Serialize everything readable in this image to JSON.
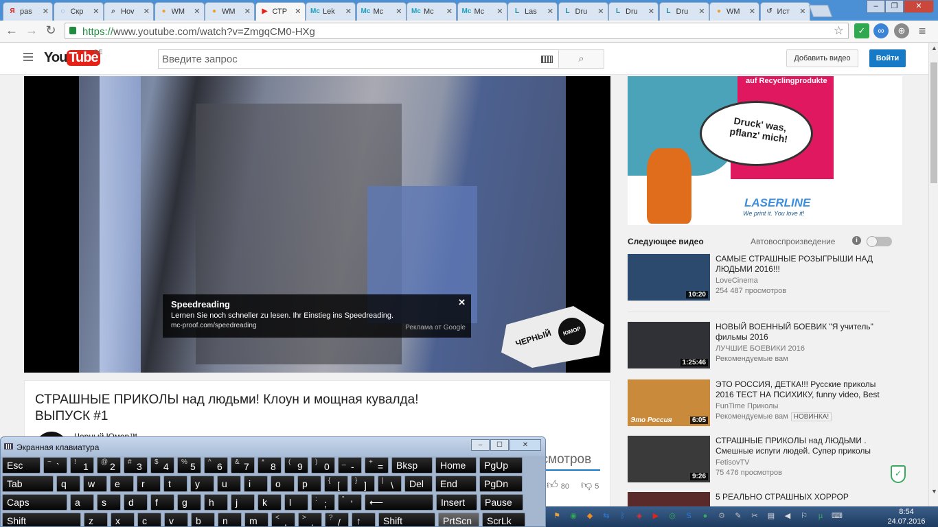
{
  "browser": {
    "tabs": [
      {
        "favicon": "Я",
        "favicon_color": "#e62117",
        "label": "pas"
      },
      {
        "favicon": "◌",
        "favicon_color": "#1a73e8",
        "label": "Скр"
      },
      {
        "favicon": "⌕",
        "favicon_color": "#555555",
        "label": "Hov"
      },
      {
        "favicon": "●",
        "favicon_color": "#f0a030",
        "label": "WM"
      },
      {
        "favicon": "●",
        "favicon_color": "#f0a030",
        "label": "WM"
      },
      {
        "favicon": "▶",
        "favicon_color": "#e62117",
        "label": "СТР",
        "active": true
      },
      {
        "favicon": "Mc",
        "favicon_color": "#1da1c1",
        "label": "Lek"
      },
      {
        "favicon": "Mc",
        "favicon_color": "#1da1c1",
        "label": "Mc"
      },
      {
        "favicon": "Mc",
        "favicon_color": "#1da1c1",
        "label": "Mc"
      },
      {
        "favicon": "Mc",
        "favicon_color": "#1da1c1",
        "label": "Mc"
      },
      {
        "favicon": "L",
        "favicon_color": "#1b8a9c",
        "label": "Las"
      },
      {
        "favicon": "L",
        "favicon_color": "#1b8a9c",
        "label": "Dru"
      },
      {
        "favicon": "L",
        "favicon_color": "#1b8a9c",
        "label": "Dru"
      },
      {
        "favicon": "L",
        "favicon_color": "#1b8a9c",
        "label": "Dru"
      },
      {
        "favicon": "●",
        "favicon_color": "#f0a030",
        "label": "WM"
      },
      {
        "favicon": "↺",
        "favicon_color": "#555555",
        "label": "Ист"
      }
    ],
    "url_scheme": "https://",
    "url_rest": "www.youtube.com/watch?v=ZmgqCM0-HXg",
    "window_buttons": {
      "minimize": "‒",
      "maximize": "❐",
      "close": "✕"
    }
  },
  "youtube": {
    "logo_you": "You",
    "logo_tube": "Tube",
    "country": "DE",
    "search_placeholder": "Введите запрос",
    "upload_label": "Добавить видео",
    "signin_label": "Войти"
  },
  "player_ad": {
    "title": "Speedreading",
    "text": "Lernen Sie noch schneller zu lesen. Ihr Einstieg ins Speedreading.",
    "url": "mc-proof.com/speedreading",
    "by": "Реклама от Google",
    "close": "✕"
  },
  "video": {
    "watermark": "ЧЕРНЫЙ",
    "watermark_badge": "ЮМОР",
    "title": "СТРАШНЫЕ ПРИКОЛЫ над людьми! Клоун и мощная кувалда! ВЫПУСК #1",
    "channel": "Черный Юмор™",
    "views_partial": "осмотров",
    "likes": "80",
    "dislikes": "5"
  },
  "sidebar_ad": {
    "tagline": "auf Recyclingprodukte",
    "bubble": "Druck' was, pflanz' mich!",
    "brand": "LASERLINE",
    "brand_tag": "We print it. You love it!"
  },
  "upnext": {
    "label": "Следующее видео",
    "autoplay_label": "Автовоспроизведение",
    "autoplay_on": false
  },
  "recommendations": [
    {
      "title": "САМЫЕ СТРАШНЫЕ РОЗЫГРЫШИ НАД ЛЮДЬМИ 2016!!!",
      "channel": "LoveCinema",
      "meta": "254 487 просмотров",
      "duration": "10:20",
      "thumb_color": "#2c4a6e"
    },
    {
      "title": "НОВЫЙ ВОЕННЫЙ БОЕВИК \"Я учитель\" фильмы 2016",
      "channel": "ЛУЧШИЕ БОЕВИКИ 2016",
      "meta": "Рекомендуемые вам",
      "duration": "1:25:46",
      "thumb_color": "#2f3136"
    },
    {
      "title": "ЭТО РОССИЯ, ДЕТКА!!! Русские приколы 2016 ТЕСТ НА ПСИХИКУ, funny video, Best",
      "channel": "FunTime Приколы",
      "meta": "Рекомендуемые вам",
      "badge": "НОВИНКА!",
      "duration": "6:05",
      "thumb_color": "#c98a3c",
      "thumb_caption": "Это Россия"
    },
    {
      "title": "СТРАШНЫЕ ПРИКОЛЫ над ЛЮДЬМИ . Смешные испуги людей. Супер приколы",
      "channel": "FetisovTV",
      "meta": "75 476 просмотров",
      "duration": "9:26",
      "thumb_color": "#3a3a3a"
    }
  ],
  "partial_rec_title": "5 РЕАЛЬНО СТРАШНЫХ ХОРРОР",
  "osk": {
    "title": "Экранная клавиатура",
    "rows": [
      [
        {
          "main": "Esc",
          "w": 58
        },
        {
          "shift": "~",
          "main": "`",
          "w": 37
        },
        {
          "shift": "!",
          "main": "1",
          "w": 37
        },
        {
          "shift": "@",
          "main": "2",
          "w": 37
        },
        {
          "shift": "#",
          "main": "3",
          "w": 37
        },
        {
          "shift": "$",
          "main": "4",
          "w": 37
        },
        {
          "shift": "%",
          "main": "5",
          "w": 37
        },
        {
          "shift": "^",
          "main": "6",
          "w": 37
        },
        {
          "shift": "&",
          "main": "7",
          "w": 37
        },
        {
          "shift": "*",
          "main": "8",
          "w": 37
        },
        {
          "shift": "(",
          "main": "9",
          "w": 37
        },
        {
          "shift": ")",
          "main": "0",
          "w": 37
        },
        {
          "shift": "_",
          "main": "-",
          "w": 37
        },
        {
          "shift": "+",
          "main": "=",
          "w": 37
        },
        {
          "main": "Bksp",
          "w": 62
        },
        {
          "main": "Home",
          "w": 62
        },
        {
          "main": "PgUp",
          "w": 65
        }
      ],
      [
        {
          "main": "Tab",
          "w": 77
        },
        {
          "main": "q",
          "w": 37
        },
        {
          "main": "w",
          "w": 37
        },
        {
          "main": "e",
          "w": 37
        },
        {
          "main": "r",
          "w": 37
        },
        {
          "main": "t",
          "w": 37
        },
        {
          "main": "y",
          "w": 37
        },
        {
          "main": "u",
          "w": 37
        },
        {
          "main": "i",
          "w": 37
        },
        {
          "main": "o",
          "w": 37
        },
        {
          "main": "p",
          "w": 37
        },
        {
          "shift": "{",
          "main": "[",
          "w": 37
        },
        {
          "shift": "}",
          "main": "]",
          "w": 37
        },
        {
          "shift": "|",
          "main": "\\",
          "w": 37
        },
        {
          "main": "Del",
          "w": 43
        },
        {
          "main": "End",
          "w": 62
        },
        {
          "main": "PgDn",
          "w": 65
        }
      ],
      [
        {
          "main": "Caps",
          "w": 97
        },
        {
          "main": "a",
          "w": 37
        },
        {
          "main": "s",
          "w": 37
        },
        {
          "main": "d",
          "w": 37
        },
        {
          "main": "f",
          "w": 37
        },
        {
          "main": "g",
          "w": 37
        },
        {
          "main": "h",
          "w": 37
        },
        {
          "main": "j",
          "w": 37
        },
        {
          "main": "k",
          "w": 37
        },
        {
          "main": "l",
          "w": 37
        },
        {
          "shift": ":",
          "main": ";",
          "w": 37
        },
        {
          "shift": "\"",
          "main": "'",
          "w": 37
        },
        {
          "main": "⟵",
          "w": 102
        },
        {
          "main": "Insert",
          "w": 62
        },
        {
          "main": "Pause",
          "w": 65
        }
      ],
      [
        {
          "main": "Shift",
          "w": 117
        },
        {
          "main": "z",
          "w": 37
        },
        {
          "main": "x",
          "w": 37
        },
        {
          "main": "c",
          "w": 37
        },
        {
          "main": "v",
          "w": 37
        },
        {
          "main": "b",
          "w": 37
        },
        {
          "main": "n",
          "w": 37
        },
        {
          "main": "m",
          "w": 37
        },
        {
          "shift": "<",
          "main": ",",
          "w": 37
        },
        {
          "shift": ">",
          "main": ".",
          "w": 37
        },
        {
          "shift": "?",
          "main": "/",
          "w": 37
        },
        {
          "main": "↑",
          "w": 37
        },
        {
          "main": "Shift",
          "w": 85
        },
        {
          "main": "PrtScn",
          "w": 62,
          "pressed": true
        },
        {
          "main": "ScrLk",
          "w": 65
        }
      ]
    ]
  },
  "taskbar": {
    "tray_icons": [
      {
        "name": "windows-flag-icon",
        "glyph": "⚑",
        "color": "#e8a23c"
      },
      {
        "name": "green-globe-icon",
        "glyph": "◉",
        "color": "#2fa84f"
      },
      {
        "name": "orange-app-icon",
        "glyph": "◆",
        "color": "#f08a24"
      },
      {
        "name": "teamviewer-icon",
        "glyph": "⇆",
        "color": "#2b7bd6"
      },
      {
        "name": "bluetooth-icon",
        "glyph": "ᛒ",
        "color": "#2b7bd6"
      },
      {
        "name": "shield-icon",
        "glyph": "◈",
        "color": "#d33"
      },
      {
        "name": "youtube-tray-icon",
        "glyph": "▶",
        "color": "#e62117"
      },
      {
        "name": "adguard-icon",
        "glyph": "◎",
        "color": "#2fa84f"
      },
      {
        "name": "skype-icon",
        "glyph": "S",
        "color": "#2b7bd6"
      },
      {
        "name": "green-circle-icon",
        "glyph": "●",
        "color": "#3aa860"
      },
      {
        "name": "gear-tray-icon",
        "glyph": "⚙",
        "color": "#aaaaaa"
      },
      {
        "name": "pin-icon",
        "glyph": "✎",
        "color": "#cccccc"
      },
      {
        "name": "tools-icon",
        "glyph": "✂",
        "color": "#cccccc"
      },
      {
        "name": "network-icon",
        "glyph": "▤",
        "color": "#dddddd"
      },
      {
        "name": "volume-icon",
        "glyph": "◀",
        "color": "#dddddd"
      },
      {
        "name": "flag-icon",
        "glyph": "⚐",
        "color": "#dddddd"
      },
      {
        "name": "utorrent-icon",
        "glyph": "µ",
        "color": "#3aa860"
      },
      {
        "name": "keyboard-layout-icon",
        "glyph": "⌨",
        "color": "#dddddd"
      }
    ],
    "time": "8:54",
    "date": "24.07.2016"
  }
}
